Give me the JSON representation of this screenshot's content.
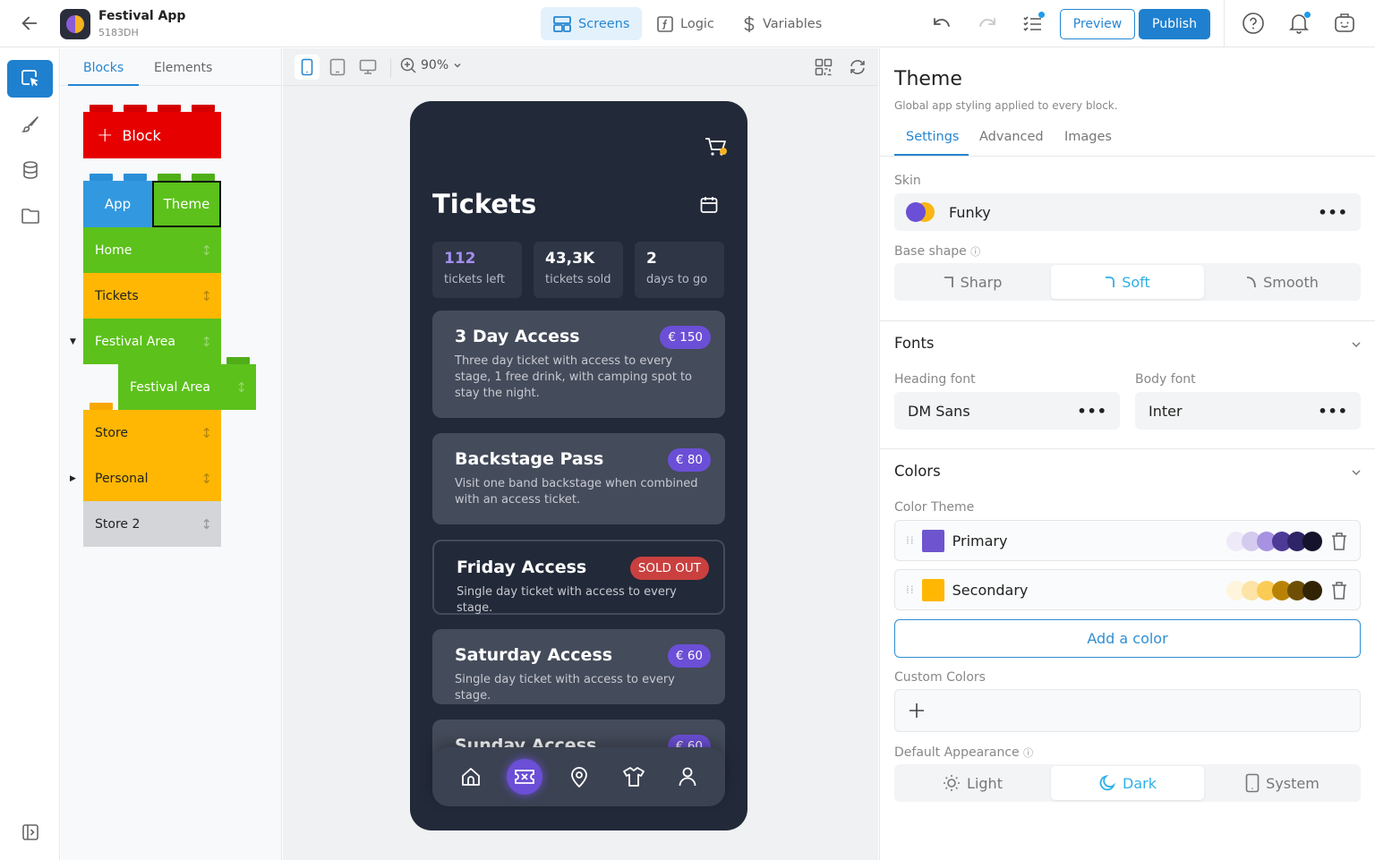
{
  "header": {
    "app_name": "Festival App",
    "app_id": "5183DH",
    "nav": [
      {
        "label": "Screens",
        "icon": "screens-icon",
        "active": true
      },
      {
        "label": "Logic",
        "icon": "function-icon",
        "active": false
      },
      {
        "label": "Variables",
        "icon": "dollar-icon",
        "active": false
      }
    ],
    "preview_label": "Preview",
    "publish_label": "Publish"
  },
  "blocks_panel": {
    "tabs": [
      {
        "label": "Blocks",
        "active": true
      },
      {
        "label": "Elements",
        "active": false
      }
    ],
    "add_block_label": "Block",
    "app_label": "App",
    "theme_label": "Theme",
    "screens": [
      {
        "label": "Home",
        "color": "#5cc11b"
      },
      {
        "label": "Tickets",
        "color": "#ffb703"
      },
      {
        "label": "Festival Area",
        "color": "#5cc11b",
        "expanded": true
      },
      {
        "label": "Festival Area",
        "color": "#5cc11b",
        "nested": true
      },
      {
        "label": "Store",
        "color": "#ffb703"
      },
      {
        "label": "Personal",
        "color": "#ffb703",
        "collapsed": true
      },
      {
        "label": "Store 2",
        "color": "#d3d5d9"
      }
    ]
  },
  "canvas": {
    "zoom": "90%",
    "phone": {
      "title": "Tickets",
      "stats": [
        {
          "value": "112",
          "label": "tickets left",
          "highlight": true
        },
        {
          "value": "43,3K",
          "label": "tickets sold"
        },
        {
          "value": "2",
          "label": "days to go"
        }
      ],
      "tickets": [
        {
          "title": "3 Day Access",
          "price": "€ 150",
          "desc": "Three day ticket with access to every stage, 1 free drink, with camping spot to stay the night."
        },
        {
          "title": "Backstage Pass",
          "price": "€ 80",
          "desc": "Visit one band backstage when combined with an access ticket."
        },
        {
          "title": "Friday Access",
          "price": "SOLD OUT",
          "desc": "Single day ticket with access to every stage.",
          "sold_out": true
        },
        {
          "title": "Saturday Access",
          "price": "€ 60",
          "desc": "Single day ticket with access to every stage."
        },
        {
          "title": "Sunday Access",
          "price": "€ 60",
          "desc": ""
        }
      ],
      "tabbar": [
        "home-icon",
        "ticket-icon",
        "map-pin-icon",
        "shirt-icon",
        "user-icon"
      ],
      "active_tab": "ticket-icon"
    }
  },
  "theme_panel": {
    "title": "Theme",
    "subtitle": "Global app styling applied to every block.",
    "tabs": [
      {
        "label": "Settings",
        "active": true
      },
      {
        "label": "Advanced"
      },
      {
        "label": "Images"
      }
    ],
    "skin_label": "Skin",
    "skin_value": "Funky",
    "base_shape_label": "Base shape",
    "base_shapes": [
      {
        "label": "Sharp"
      },
      {
        "label": "Soft",
        "active": true
      },
      {
        "label": "Smooth"
      }
    ],
    "fonts_title": "Fonts",
    "heading_font_label": "Heading font",
    "heading_font": "DM Sans",
    "body_font_label": "Body font",
    "body_font": "Inter",
    "colors_title": "Colors",
    "color_theme_label": "Color Theme",
    "colors": [
      {
        "name": "Primary",
        "hex": "#6e55cf",
        "shades": [
          "#eeeaf8",
          "#d4cbef",
          "#a692e0",
          "#4d3a97",
          "#2e2466",
          "#15122b"
        ]
      },
      {
        "name": "Secondary",
        "hex": "#ffb703",
        "shades": [
          "#fff5dc",
          "#fde3a6",
          "#fbcc55",
          "#b88305",
          "#6e4f05",
          "#312304"
        ]
      }
    ],
    "add_color_label": "Add a color",
    "custom_colors_label": "Custom Colors",
    "appearance_label": "Default Appearance",
    "appearances": [
      {
        "label": "Light"
      },
      {
        "label": "Dark",
        "active": true
      },
      {
        "label": "System"
      }
    ]
  }
}
